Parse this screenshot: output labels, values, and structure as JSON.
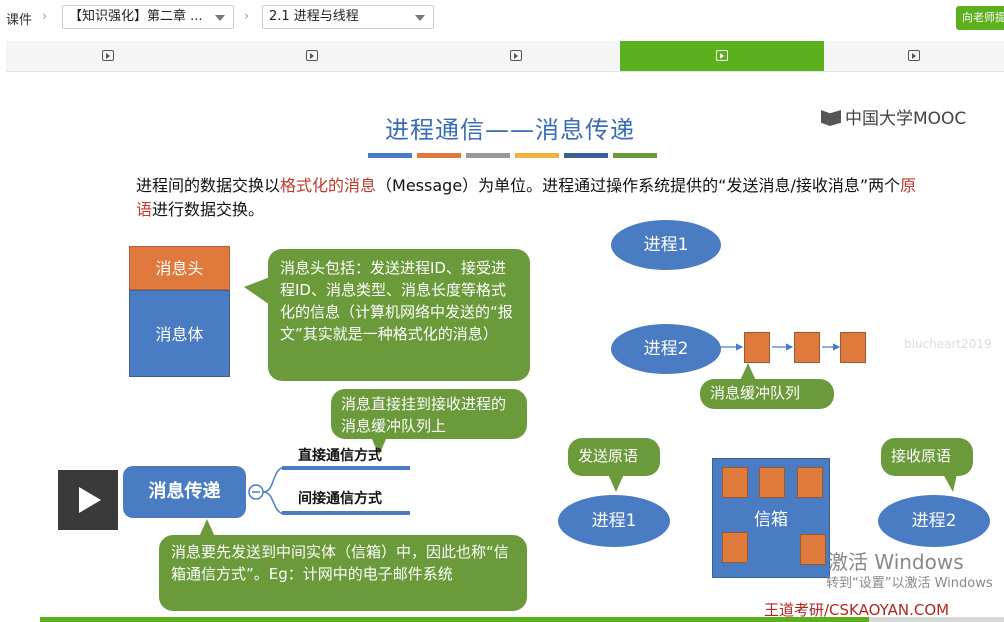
{
  "breadcrumb": {
    "root": "课件",
    "chapter": "【知识强化】第二章 ...",
    "lesson": "2.1 进程与线程"
  },
  "ask_teacher_label": "向老师提问",
  "colors": {
    "accent": "#5cb01d",
    "blue": "#4a7cc4",
    "orange": "#e07a3c",
    "green_bubble": "#6a9a3a",
    "title": "#3a6db5"
  },
  "tabs": [
    {
      "icon": "play-square-icon",
      "active": false
    },
    {
      "icon": "play-square-icon",
      "active": false
    },
    {
      "icon": "play-square-icon",
      "active": false
    },
    {
      "icon": "play-square-icon",
      "active": true
    },
    {
      "icon": "play-square-icon",
      "active": false
    }
  ],
  "slide": {
    "title": "进程通信——消息传递",
    "logo": "中国大学MOOC",
    "intro": {
      "p1": "进程间的数据交换以",
      "hl1": "格式化的消息",
      "p2": "（Message）为单位。进程通过操作系统提供的“发送消息/接收消息”两个",
      "hl2": "原语",
      "p3": "进行数据交换。"
    },
    "msg_header": "消息头",
    "msg_body": "消息体",
    "header_note": "消息头包括：发送进程ID、接受进程ID、消息类型、消息长度等格式化的信息（计算机网络中发送的“报文”其实就是一种格式化的消息）",
    "direct_note": "消息直接挂到接收进程的消息缓冲队列上",
    "root_node": "消息传递",
    "direct_method": "直接通信方式",
    "indirect_method": "间接通信方式",
    "indirect_note": "消息要先发送到中间实体（信箱）中，因此也称“信箱通信方式”。Eg：计网中的电子邮件系统",
    "process1_top": "进程1",
    "process2_mid": "进程2",
    "queue_label": "消息缓冲队列",
    "send_primitive": "发送原语",
    "recv_primitive": "接收原语",
    "process1_bottom": "进程1",
    "process2_bottom": "进程2",
    "mailbox": "信箱",
    "watermark": "blucheart2019",
    "windows_line1": "激活 Windows",
    "windows_line2": "转到“设置”以激活 Windows",
    "footer": "王道考研/CSKAOYAN.COM"
  },
  "video_progress": 0.86
}
